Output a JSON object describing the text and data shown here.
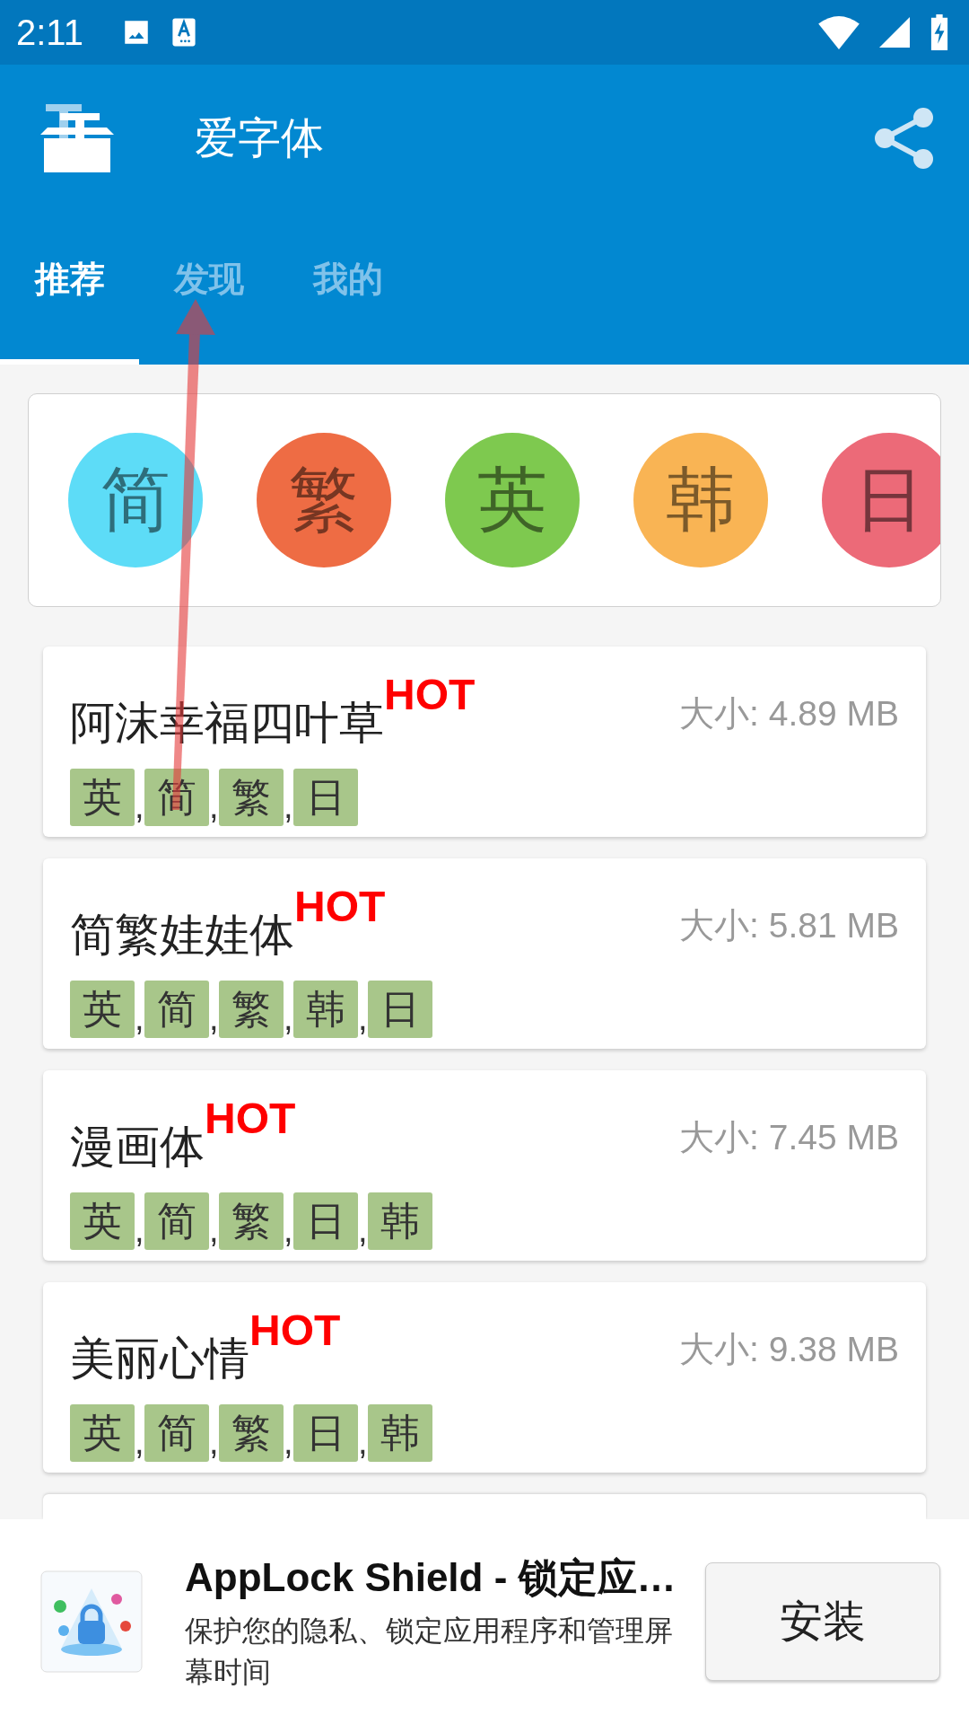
{
  "status_bar": {
    "time": "2:11"
  },
  "app_bar": {
    "title": "爱字体"
  },
  "tabs": [
    {
      "label": "推荐",
      "selected": true
    },
    {
      "label": "发现",
      "selected": false
    },
    {
      "label": "我的",
      "selected": false
    }
  ],
  "categories": [
    {
      "label": "简",
      "color": "#5ddcf7"
    },
    {
      "label": "繁",
      "color": "#ee6c44"
    },
    {
      "label": "英",
      "color": "#7ec94f"
    },
    {
      "label": "韩",
      "color": "#f9b454"
    },
    {
      "label": "日",
      "color": "#ec6a78"
    }
  ],
  "fonts": [
    {
      "name": "阿沫幸福四叶草",
      "badge": "HOT",
      "size": "大小: 4.89 MB",
      "tags": [
        "英",
        "简",
        "繁",
        "日"
      ]
    },
    {
      "name": "简繁娃娃体",
      "badge": "HOT",
      "size": "大小: 5.81 MB",
      "tags": [
        "英",
        "简",
        "繁",
        "韩",
        "日"
      ]
    },
    {
      "name": "漫画体",
      "badge": "HOT",
      "size": "大小: 7.45 MB",
      "tags": [
        "英",
        "简",
        "繁",
        "日",
        "韩"
      ]
    },
    {
      "name": "美丽心情",
      "badge": "HOT",
      "size": "大小: 9.38 MB",
      "tags": [
        "英",
        "简",
        "繁",
        "日",
        "韩"
      ]
    }
  ],
  "separator": ",",
  "ad": {
    "title": "AppLock Shield - 锁定应…",
    "description": "保护您的隐私、锁定应用程序和管理屏幕时间",
    "button": "安装"
  }
}
